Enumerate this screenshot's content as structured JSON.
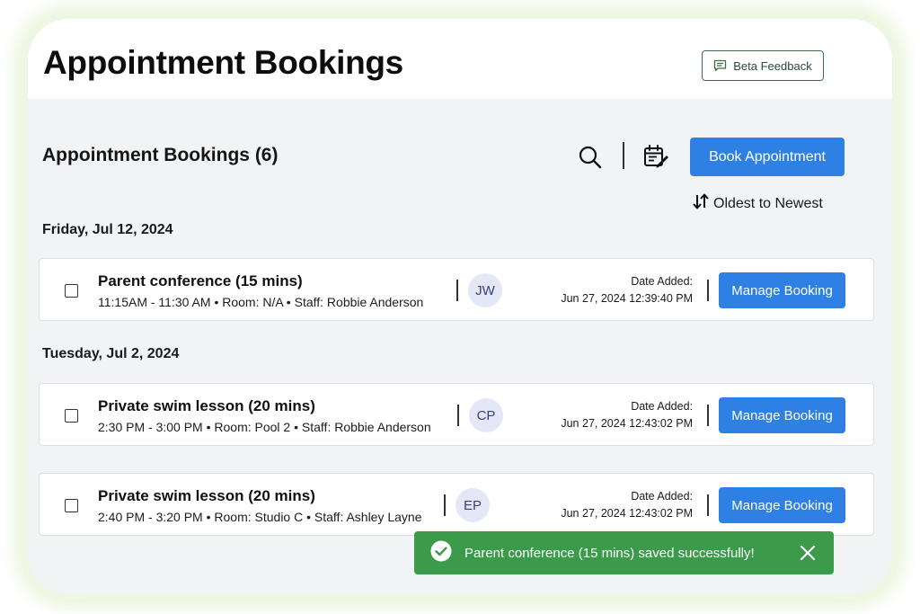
{
  "header": {
    "title": "Appointment Bookings",
    "beta_feedback_label": "Beta Feedback"
  },
  "toolbar": {
    "section_title": "Appointment Bookings (6)",
    "book_label": "Book Appointment",
    "sort_label": "Oldest to Newest",
    "icons": [
      "search-icon",
      "calendar-edit-icon",
      "sort-arrows-icon"
    ]
  },
  "groups": [
    {
      "date": "Friday, Jul 12, 2024",
      "bookings": [
        {
          "title": "Parent conference (15 mins)",
          "details": "11:15AM - 11:30 AM • Room: N/A • Staff: Robbie Anderson",
          "initials": "JW",
          "date_added_label": "Date Added:",
          "date_added": "Jun 27, 2024 12:39:40 PM",
          "manage_label": "Manage Booking"
        }
      ]
    },
    {
      "date": "Tuesday, Jul 2, 2024",
      "bookings": [
        {
          "title": "Private swim lesson (20 mins)",
          "details": "2:30 PM - 3:00 PM • Room: Pool 2 • Staff: Robbie Anderson",
          "initials": "CP",
          "date_added_label": "Date Added:",
          "date_added": "Jun 27, 2024 12:43:02 PM",
          "manage_label": "Manage Booking"
        },
        {
          "title": "Private swim lesson (20 mins)",
          "details": "2:40 PM - 3:20 PM • Room: Studio C • Staff: Ashley Layne",
          "initials": "EP",
          "date_added_label": "Date Added:",
          "date_added": "Jun 27, 2024 12:43:02 PM",
          "manage_label": "Manage Booking"
        }
      ]
    }
  ],
  "toast": {
    "message": "Parent conference (15 mins) saved successfully!",
    "icon": "check-circle-icon",
    "close_icon": "close-icon"
  },
  "colors": {
    "primary": "#2f80e4",
    "success": "#3c9a4b",
    "avatar_bg": "#e4e7f5",
    "avatar_text": "#3a3f7a",
    "page_bg": "#f1f3f5",
    "beta_border": "#3d6b4f"
  }
}
